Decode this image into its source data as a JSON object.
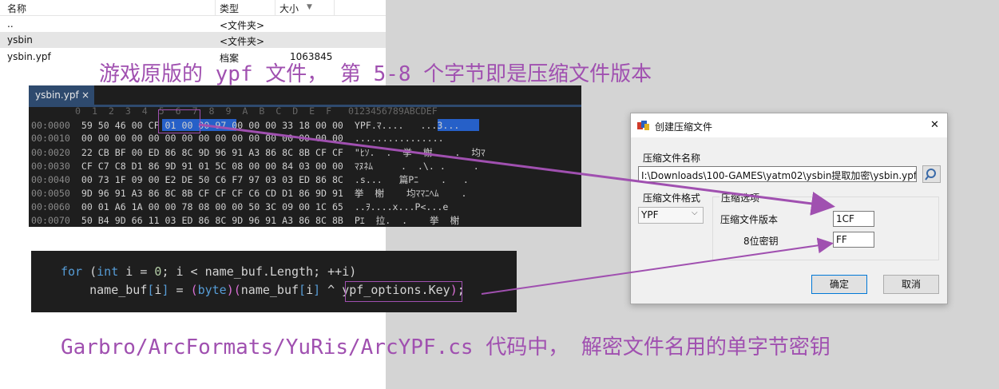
{
  "file_list": {
    "headers": {
      "name": "名称",
      "type": "类型",
      "size": "大小"
    },
    "rows": [
      {
        "name": "..",
        "type": "<文件夹>",
        "size": ""
      },
      {
        "name": "ysbin",
        "type": "<文件夹>",
        "size": ""
      },
      {
        "name": "ysbin.ypf",
        "type": "档案",
        "size": "1063845"
      }
    ]
  },
  "captions": {
    "top": "游戏原版的 ypf 文件， 第 5-8 个字节即是压缩文件版本",
    "bottom": "Garbro/ArcFormats/YuRis/ArcYPF.cs 代码中， 解密文件名用的单字节密钥"
  },
  "hex_editor": {
    "tab_label": "ysbin.ypf",
    "tab_close": "×",
    "header": "0  1  2  3  4  5  6  7  8  9  A  B  C  D  E  F   0123456789ABCDEF",
    "rows": [
      {
        "addr": "00:0000",
        "bytes": "59 50 46 00 CF 01 00 00 97 00 00 00 33 18 00 00",
        "ascii": "YPF.ﾏ....   ...3..."
      },
      {
        "addr": "00:0010",
        "bytes": "00 00 00 00 00 00 00 00 00 00 00 00 00 00 00 00",
        "ascii": "................"
      },
      {
        "addr": "00:0020",
        "bytes": "22 CB BF 00 ED 86 8C 9D 96 91 A3 86 8C 8B CF CF",
        "ascii": "\"ﾋｿ.  .  挙  榭    .  均ﾏ"
      },
      {
        "addr": "00:0030",
        "bytes": "CF C7 C8 D1 86 9D 91 01 5C 08 00 00 84 03 00 00",
        "ascii": "ﾏﾇﾈﾑ     .  .\\. .     ."
      },
      {
        "addr": "00:0040",
        "bytes": "00 73 1F 09 00 E2 DE 50 C6 F7 97 03 03 ED 86 8C",
        "ascii": ".s...   篇Pﾆ    .   ."
      },
      {
        "addr": "00:0050",
        "bytes": "9D 96 91 A3 86 8C 8B CF CF CF C6 CD D1 86 9D 91",
        "ascii": "挙  榭    均ﾏﾏﾆﾍﾑ    ."
      },
      {
        "addr": "00:0060",
        "bytes": "00 01 A6 1A 00 00 78 08 00 00 50 3C 09 00 1C 65",
        "ascii": "..ｦ....x...P<...e"
      },
      {
        "addr": "00:0070",
        "bytes": "50 B4 9D 66 11 03 ED 86 8C 9D 96 91 A3 86 8C 8B",
        "ascii": "Pｴ  拉.  .    挙  榭"
      }
    ]
  },
  "code": {
    "line1": [
      {
        "t": "for",
        "c": "kw"
      },
      {
        "t": " (",
        "c": ""
      },
      {
        "t": "int",
        "c": "kw"
      },
      {
        "t": " i = ",
        "c": ""
      },
      {
        "t": "0",
        "c": "num"
      },
      {
        "t": "; i < name_buf.Length; ++i)",
        "c": ""
      }
    ],
    "line2": [
      {
        "t": "    name_buf",
        "c": ""
      },
      {
        "t": "[",
        "c": "kw"
      },
      {
        "t": "i",
        "c": ""
      },
      {
        "t": "]",
        "c": "kw"
      },
      {
        "t": " = ",
        "c": ""
      },
      {
        "t": "(",
        "c": "pr"
      },
      {
        "t": "byte",
        "c": "kw"
      },
      {
        "t": ")",
        "c": "pr"
      },
      {
        "t": "(",
        "c": "pr"
      },
      {
        "t": "name_buf",
        "c": ""
      },
      {
        "t": "[",
        "c": "kw"
      },
      {
        "t": "i",
        "c": ""
      },
      {
        "t": "]",
        "c": "kw"
      },
      {
        "t": " ^ ",
        "c": ""
      },
      {
        "t": "ypf_options.Key",
        "c": ""
      },
      {
        "t": ")",
        "c": "pr"
      },
      {
        "t": ";",
        "c": ""
      }
    ]
  },
  "dialog": {
    "title": "创建压缩文件",
    "close": "✕",
    "archive_name_label": "压缩文件名称",
    "archive_path": "I:\\Downloads\\100-GAMES\\yatm02\\ysbin提取加密\\ysbin.ypf",
    "format_label": "压缩文件格式",
    "format_value": "YPF",
    "options_group_label": "压缩选项",
    "version_label": "压缩文件版本",
    "version_value": "1CF",
    "key_label": "8位密钥",
    "key_value": "FF",
    "ok_label": "确定",
    "cancel_label": "取消"
  },
  "colors": {
    "annotation": "#a050b0",
    "hex_highlight": "#2660c8"
  }
}
